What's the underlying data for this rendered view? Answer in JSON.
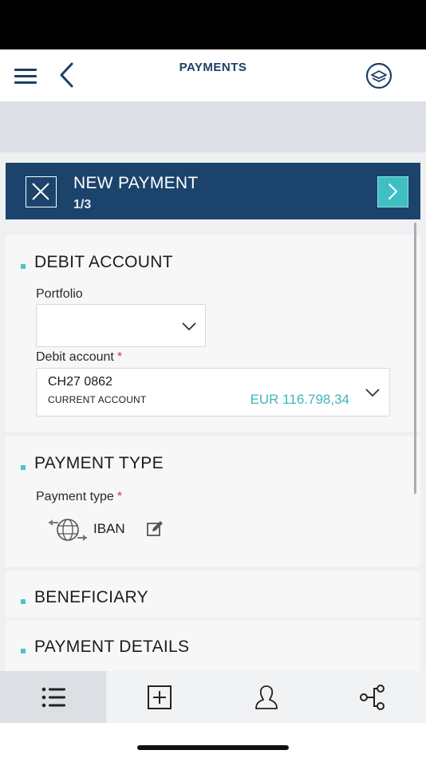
{
  "header": {
    "title": "PAYMENTS",
    "menu_icon": "hamburger-menu-icon",
    "back_icon": "chevron-left-icon",
    "logo_icon": "bank-logo-icon"
  },
  "wizard": {
    "title": "NEW PAYMENT",
    "step": "1/3",
    "close_icon": "close-icon",
    "next_icon": "chevron-right-icon"
  },
  "debit_account_section": {
    "title": "DEBIT ACCOUNT",
    "portfolio_label": "Portfolio",
    "portfolio_value": "",
    "debit_account_label": "Debit account",
    "required_mark": "*",
    "account_number": "CH27 0862",
    "account_type": "CURRENT ACCOUNT",
    "account_balance": "EUR 116.798,34"
  },
  "payment_type_section": {
    "title": "PAYMENT TYPE",
    "payment_type_label": "Payment type",
    "required_mark": "*",
    "selected_type": "IBAN",
    "type_icon": "globe-transfer-icon",
    "edit_icon": "edit-icon"
  },
  "beneficiary_section": {
    "title": "BENEFICIARY"
  },
  "payment_details_section": {
    "title": "PAYMENT DETAILS"
  },
  "tab_bar": {
    "tabs": [
      {
        "name": "list",
        "icon": "list-icon",
        "active": true
      },
      {
        "name": "new",
        "icon": "add-square-icon",
        "active": false
      },
      {
        "name": "contacts",
        "icon": "person-icon",
        "active": false
      },
      {
        "name": "share",
        "icon": "share-icon",
        "active": false
      }
    ]
  },
  "colors": {
    "navy": "#1b436b",
    "teal": "#3fbfc4",
    "required": "#d03a3a"
  }
}
